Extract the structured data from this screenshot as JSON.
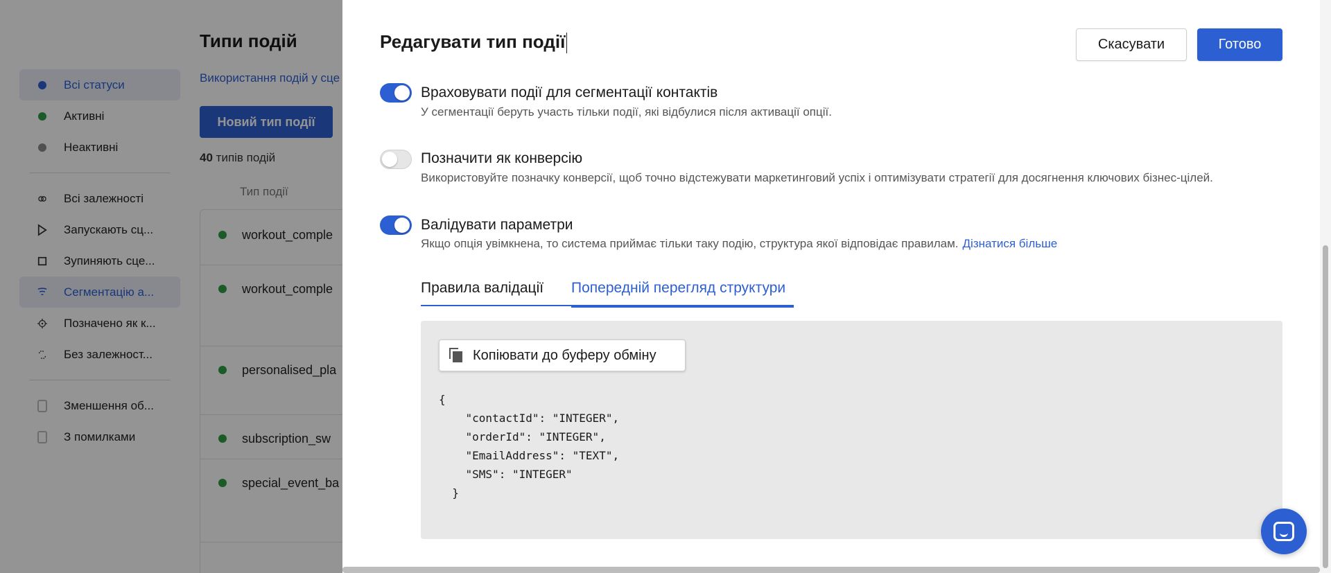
{
  "background": {
    "sidebar": {
      "status_items": [
        {
          "label": "Всі статуси",
          "color": "#2c5fd1",
          "active": true
        },
        {
          "label": "Активні",
          "color": "#2e9e46",
          "active": false
        },
        {
          "label": "Неактивні",
          "color": "#8a8a8a",
          "active": false
        }
      ],
      "dependency_items": [
        {
          "label": "Всі залежності",
          "icon": "link-icon"
        },
        {
          "label": "Запускають сц...",
          "icon": "play-icon"
        },
        {
          "label": "Зупиняють сце...",
          "icon": "stop-icon"
        },
        {
          "label": "Сегментацію а...",
          "icon": "filter-icon",
          "active": true
        },
        {
          "label": "Позначено як к...",
          "icon": "target-icon"
        },
        {
          "label": "Без залежност...",
          "icon": "unlink-icon"
        }
      ],
      "filter_items": [
        {
          "label": "Зменшення об..."
        },
        {
          "label": "З помилками"
        }
      ]
    },
    "main": {
      "title": "Типи подій",
      "usage_link": "Використання подій у сце",
      "new_button": "Новий тип події",
      "count_number": "40",
      "count_label": "типів подій",
      "column_header": "Тип події",
      "rows": [
        {
          "name": "workout_comple"
        },
        {
          "name": "workout_comple"
        },
        {
          "name": "personalised_pla"
        },
        {
          "name": "subscription_sw"
        },
        {
          "name": "special_event_ba"
        }
      ]
    }
  },
  "drawer": {
    "title": "Редагувати тип події",
    "cancel_label": "Скасувати",
    "done_label": "Готово",
    "options": [
      {
        "label": "Враховувати події для сегментації контактів",
        "description": "У сегментації беруть участь тільки події, які відбулися після активації опції.",
        "enabled": true
      },
      {
        "label": "Позначити як конверсію",
        "description": "Використовуйте позначку конверсії, щоб точно відстежувати маркетинговий успіх і оптимізувати стратегії для досягнення ключових бізнес-цілей.",
        "enabled": false
      },
      {
        "label": "Валідувати параметри",
        "description": "Якщо опція увімкнена, то система приймає тільки таку подію, структура якої відповідає правилам.",
        "link": "Дізнатися більше",
        "enabled": true
      }
    ],
    "tabs": [
      {
        "label": "Правила валідації",
        "active": false
      },
      {
        "label": "Попередній перегляд структури",
        "active": true
      }
    ],
    "copy_button": "Копіювати до буферу обміну",
    "code": "{\n    \"contactId\": \"INTEGER\",\n    \"orderId\": \"INTEGER\",\n    \"EmailAddress\": \"TEXT\",\n    \"SMS\": \"INTEGER\"\n  }"
  },
  "colors": {
    "accent": "#2c5fd1",
    "active_green": "#2e9e46"
  }
}
